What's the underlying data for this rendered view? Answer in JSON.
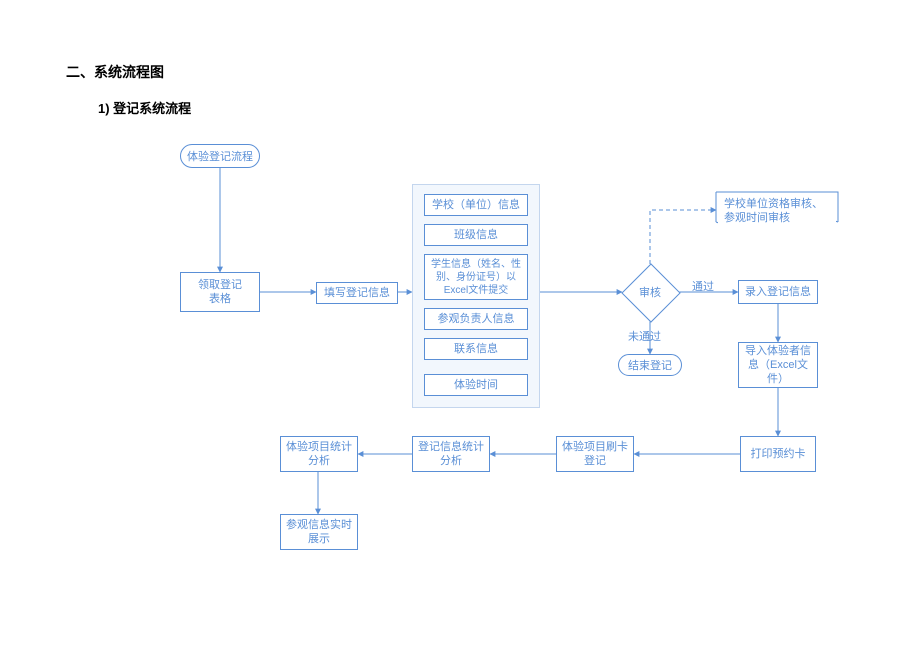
{
  "headings": {
    "h1": "二、系统流程图",
    "h2": "1)  登记系统流程"
  },
  "nodes": {
    "start": "体验登记流程",
    "collect_form": "领取登记\n表格",
    "fill_info": "填写登记信息",
    "details": {
      "school": "学校（单位）信息",
      "class": "班级信息",
      "student": "学生信息（姓名、性别、身份证号）以Excel文件提交",
      "visit_leader": "参观负责人信息",
      "contact": "联系信息",
      "exp_time": "体验时间"
    },
    "review": "审核",
    "review_note": "学校单位资格审核、参观时间审核",
    "pass": "通过",
    "fail": "未通过",
    "end_reg": "结束登记",
    "input_info": "录入登记信息",
    "import_info": "导入体验者信息（Excel文件）",
    "print_card": "打印预约卡",
    "swipe_reg": "体验项目刷卡登记",
    "reg_stat": "登记信息统计分析",
    "proj_stat": "体验项目统计分析",
    "visit_show": "参观信息实时展示"
  }
}
